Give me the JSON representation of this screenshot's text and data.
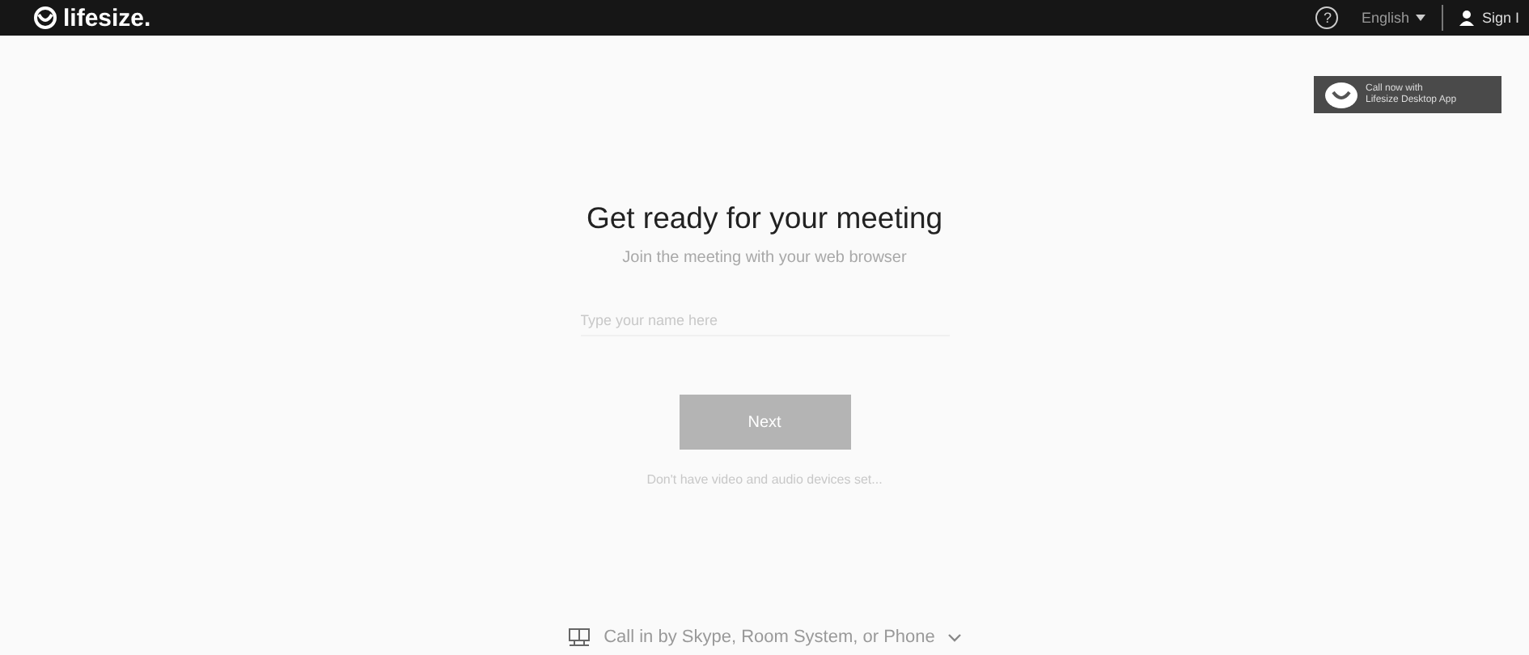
{
  "top_bar": {
    "logo": "lifesize.",
    "help": "?",
    "language": "English",
    "sign_in": "Sign I"
  },
  "desktop_app": {
    "line_1": "Call now with",
    "line_2": "Lifesize Desktop App"
  },
  "main": {
    "title": "Get ready for your meeting",
    "subtitle": "Join the meeting with your web browser",
    "name_field": {
      "placeholder": "Type your name here"
    },
    "next_button": {
      "label": "Next",
      "disabled": true
    },
    "help_link": "Don't have video and audio devices set..."
  },
  "call_in": {
    "label": "Call in by Skype, Room System, or Phone",
    "expanded": false
  }
}
